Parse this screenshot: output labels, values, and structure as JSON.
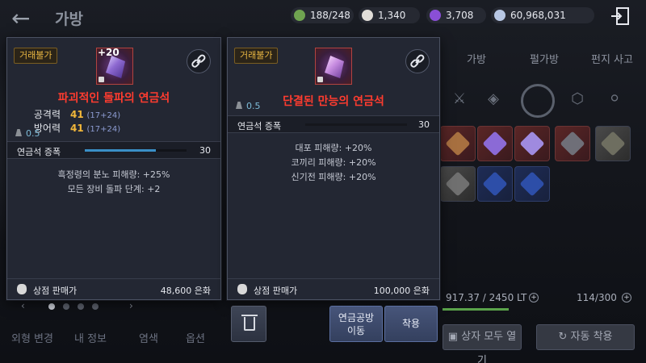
{
  "header": {
    "back_icon": "back-arrow-icon",
    "title": "가방",
    "currencies": [
      {
        "icon": "green-stone-icon",
        "value": "188/248",
        "color": "#6fa350"
      },
      {
        "icon": "pearl-icon",
        "value": "1,340",
        "color": "#e0ddd8"
      },
      {
        "icon": "purple-orb-icon",
        "value": "3,708",
        "color": "#8a4fd6"
      },
      {
        "icon": "silver-coin-icon",
        "value": "60,968,031",
        "color": "#b7c7e4"
      }
    ],
    "exit_icon": "exit-door-icon"
  },
  "inventory": {
    "tabs": [
      "가방",
      "펄가방",
      "펀지 사고"
    ],
    "weight": "917.37 / 2450 LT",
    "slots": "114/300",
    "open_all_label": "상자 모두 열기",
    "auto_equip_label": "자동 착용"
  },
  "character_tabs": [
    "외형 변경",
    "내 정보",
    "염색",
    "옵션"
  ],
  "card1": {
    "badge": "거래불가",
    "enhance": "+20",
    "name": "파괴적인 돌파의 연금석",
    "stats": [
      {
        "label": "공격력",
        "value": "41",
        "detail": "(17+24)"
      },
      {
        "label": "방어력",
        "value": "41",
        "detail": "(17+24)"
      }
    ],
    "weight": "0.5",
    "amp_label": "연금석 증폭",
    "amp_value": "30",
    "amp_fill": 0.7,
    "effects": [
      "흑정령의 분노 피해량: +25%",
      "모든 장비 돌파 단계: +2"
    ],
    "sell_label": "상점 판매가",
    "sell_price": "48,600 은화"
  },
  "card2": {
    "badge": "거래불가",
    "name": "단결된 만능의 연금석",
    "weight": "0.5",
    "amp_label": "연금석 증폭",
    "amp_value": "30",
    "amp_fill": 1.0,
    "effects": [
      "대포 피해량: +20%",
      "코끼리 피해량: +20%",
      "신기전 피해량: +20%"
    ],
    "sell_label": "상점 판매가",
    "sell_price": "100,000 은화"
  },
  "actions": {
    "trash_icon": "trash-icon",
    "lab_line1": "연금공방",
    "lab_line2": "이동",
    "equip": "착용"
  }
}
